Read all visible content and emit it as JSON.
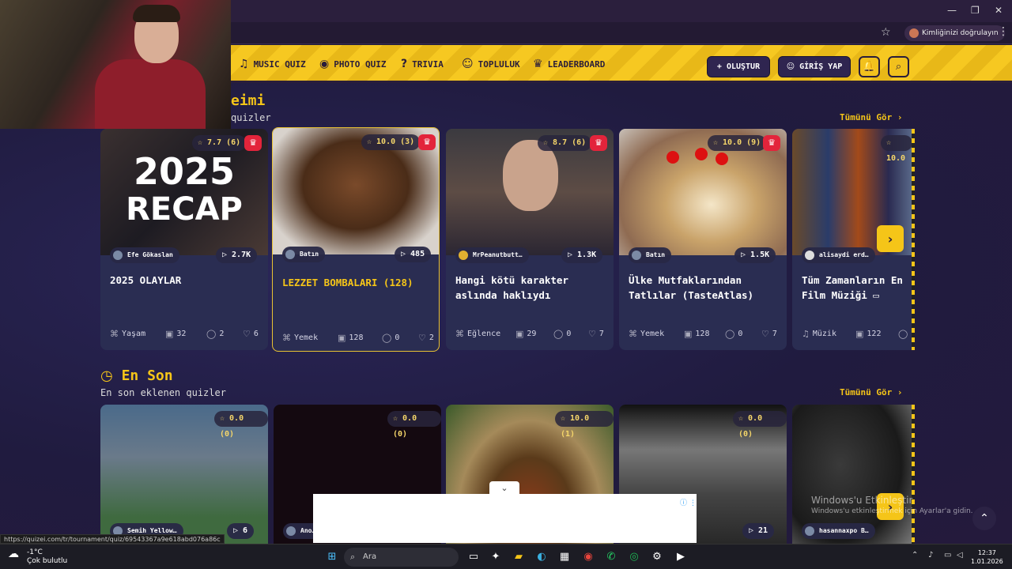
{
  "browser": {
    "profile_label": "Kimliğinizi doğrulayın",
    "status_url": "https://quizei.com/tr/tournament/quiz/69543367a9e618abd076a86c"
  },
  "nav": {
    "items": [
      {
        "label": "MUSIC QUIZ",
        "icon": "♫"
      },
      {
        "label": "PHOTO QUIZ",
        "icon": "◉"
      },
      {
        "label": "TRIVIA",
        "icon": "?"
      },
      {
        "label": "TOPLULUK",
        "icon": "☺"
      },
      {
        "label": "LEADERBOARD",
        "icon": "♛"
      }
    ],
    "create_label": "+ OLUŞTUR",
    "login_label": "GİRİŞ YAP",
    "bell_icon": "🔔",
    "search_icon": "⌕"
  },
  "section1": {
    "title_fragment": "eimi",
    "subtitle_fragment": "quizler",
    "see_all": "Tümünü Gör ›",
    "cards": [
      {
        "rating": "☆ 7.7 (6)",
        "author": "Efe Gökaslan",
        "plays": "▷ 2.7K",
        "title": "2025 OLAYLAR",
        "category": "Yaşam",
        "questions": "32",
        "comments": "2",
        "likes": "6",
        "image_text1": "2025",
        "image_text2": "RECAP"
      },
      {
        "rating": "☆ 10.0 (3)",
        "author": "Batın",
        "plays": "▷ 485",
        "title": "LEZZET BOMBALARI (128)",
        "category": "Yemek",
        "questions": "128",
        "comments": "0",
        "likes": "2"
      },
      {
        "rating": "☆ 8.7 (6)",
        "author": "MrPeanutbutt…",
        "plays": "▷ 1.3K",
        "title": "Hangi kötü karakter aslında haklıydı",
        "category": "Eğlence",
        "questions": "29",
        "comments": "0",
        "likes": "7"
      },
      {
        "rating": "☆ 10.0 (9)",
        "author": "Batın",
        "plays": "▷ 1.5K",
        "title": "Ülke Mutfaklarından Tatlılar (TasteAtlas)",
        "category": "Yemek",
        "questions": "128",
        "comments": "0",
        "likes": "7"
      },
      {
        "rating": "☆ 10.0",
        "author": "alisaydi erd…",
        "plays": "",
        "title": "Tüm Zamanların En Film Müziği ▭",
        "category": "Müzik",
        "questions": "122",
        "comments": "",
        "likes": ""
      }
    ]
  },
  "section2": {
    "title": "En Son",
    "subtitle": "En son eklenen quizler",
    "see_all": "Tümünü Gör ›",
    "cards": [
      {
        "rating": "☆ 0.0 (0)",
        "author": "Semih Yellow…",
        "plays": "▷ 6"
      },
      {
        "rating": "☆ 0.0 (0)",
        "author": "Ano…",
        "plays": ""
      },
      {
        "rating": "☆ 10.0 (1)",
        "author": "",
        "plays": ""
      },
      {
        "rating": "☆ 0.0 (0)",
        "author": "",
        "plays": "▷ 21"
      },
      {
        "rating": "",
        "author": "hasannaxpo B…",
        "plays": ""
      }
    ]
  },
  "overlay": {
    "watermark_line1": "Windows'u Etkinleştir",
    "watermark_line2": "Windows'u etkinleştirmek için Ayarlar'a gidin."
  },
  "taskbar": {
    "temp": "-1°C",
    "condition": "Çok bulutlu",
    "search_label": "Ara",
    "time": "12:37",
    "date": "1.01.2026"
  },
  "colors": {
    "accent": "#f5c518",
    "card_bg": "#2a2d52",
    "crown_red": "#e3243b"
  }
}
